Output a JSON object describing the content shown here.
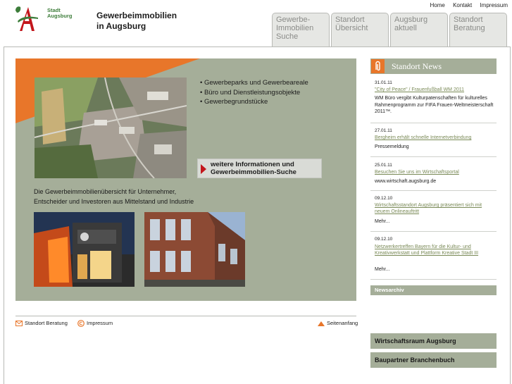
{
  "top_links": [
    "Home",
    "Kontakt",
    "Impressum"
  ],
  "logo": {
    "line1": "Stadt",
    "line2": "Augsburg"
  },
  "site_title": {
    "line1": "Gewerbeimmobilien",
    "line2": "in Augsburg"
  },
  "tabs": [
    {
      "lines": [
        "Gewerbe-",
        "Immobilien",
        "Suche"
      ]
    },
    {
      "lines": [
        "Standort",
        "Übersicht"
      ]
    },
    {
      "lines": [
        "Augsburg",
        "aktuell"
      ]
    },
    {
      "lines": [
        "Standort",
        "Beratung"
      ]
    }
  ],
  "hero": {
    "bullets": [
      "Gewerbeparks und Gewerbeareale",
      "Büro und Dienstleistungsobjekte",
      "Gewerbegrundstücke"
    ],
    "cta_line1": "weitere Informationen und",
    "cta_line2": "Gewerbeimmobilien-Suche",
    "intro_line1": "Die Gewerbeimmobilienübersicht für Unternehmer,",
    "intro_line2": "Entscheider und Investoren aus Mittelstand und Industrie"
  },
  "footer": {
    "beratung": "Standort Beratung",
    "impressum": "Impressum",
    "seitenanfang": "Seitenanfang"
  },
  "news": {
    "title": "Standort News",
    "items": [
      {
        "date": "31.01.11",
        "link": "\"City of Peace\" / Frauenfußball WM 2011",
        "body": "WM Büro vergibt Kulturpatenschaften für kulturelles Rahmenprogramm zur FIFA Frauen-Weltmeisterschaft 2011™."
      },
      {
        "date": "27.01.11",
        "link": "Bergheim erhält schnelle Internetverbindung",
        "body": "Pressemeldung"
      },
      {
        "date": "25.01.11",
        "link": "Besuchen Sie uns im Wirtschaftsportal",
        "body": "www.wirtschaft.augsburg.de"
      },
      {
        "date": "09.12.10",
        "link": "Wirtschaftsstandort Augsburg präsentiert sich mit neuem Onlineauftritt",
        "body": "Mehr..."
      },
      {
        "date": "09.12.10",
        "link": "Netzwerkertreffen Bayern für die Kultur- und Kreativwerkstatt und Plattform Kreative Stadt III",
        "body": "Mehr..."
      }
    ],
    "archive": "Newsarchiv"
  },
  "side_buttons": [
    "Wirtschaftsraum Augsburg",
    "Baupartner Branchenbuch"
  ],
  "colors": {
    "sage": "#a5ae99",
    "orange": "#e8762a",
    "red_arrow": "#c3161c",
    "link_green": "#7a8a57",
    "logo_red": "#c3161c",
    "logo_green": "#3d7d3a"
  }
}
